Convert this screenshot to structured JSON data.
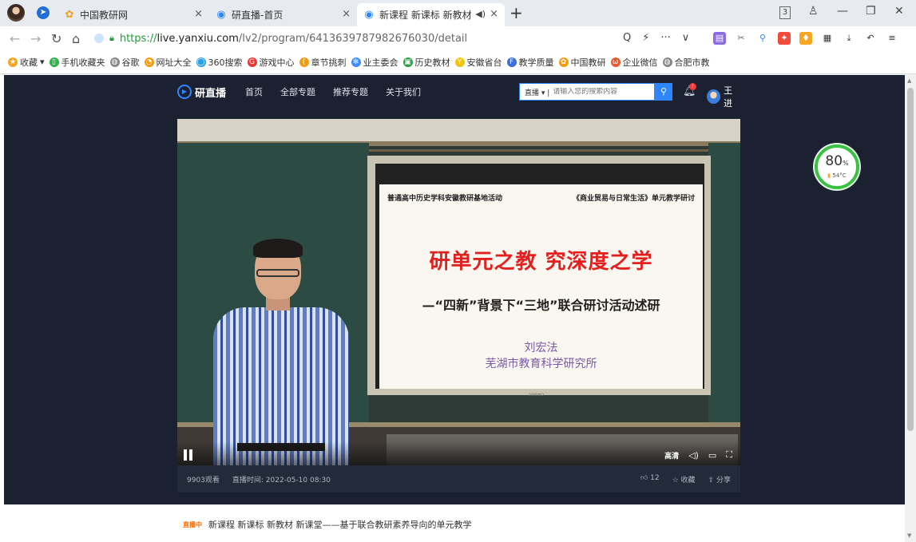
{
  "browser": {
    "tabs": [
      {
        "title": "中国教研网",
        "close": "×"
      },
      {
        "title": "研直播-首页",
        "close": "×"
      },
      {
        "title": "新课程  新课标  新教材",
        "close": "×",
        "sound": "◀)"
      }
    ],
    "new_tab": "+",
    "window_controls": {
      "sidebar_count": "3",
      "minimize": "—",
      "restore": "❐",
      "close": "✕"
    },
    "url": {
      "scheme": "https://",
      "host": "live.yanxiu.com",
      "path": "/lv2/program/6413639787982676030/detail"
    },
    "url_tools": [
      "Q",
      "⚡",
      "···",
      "∨"
    ],
    "bookmarks": [
      {
        "label": "收藏",
        "color": "#f5a623"
      },
      {
        "label": "手机收藏夹",
        "color": "#2fb24a"
      },
      {
        "label": "谷歌",
        "color": "#888888"
      },
      {
        "label": "网址大全",
        "color": "#f39c12"
      },
      {
        "label": "360搜索",
        "color": "#2aa1e6"
      },
      {
        "label": "游戏中心",
        "color": "#e53935"
      },
      {
        "label": "章节挑刺",
        "color": "#f39c12"
      },
      {
        "label": "业主委会",
        "color": "#3d8bfd"
      },
      {
        "label": "历史教材",
        "color": "#2e9d46"
      },
      {
        "label": "安徽省台",
        "color": "#f1c40f"
      },
      {
        "label": "教学质量",
        "color": "#3d6cd6"
      },
      {
        "label": "中国教研",
        "color": "#f39c12"
      },
      {
        "label": "企业微信",
        "color": "#e65b2f"
      },
      {
        "label": "合肥市教",
        "color": "#888888"
      }
    ]
  },
  "site": {
    "logo": "研直播",
    "nav": [
      "首页",
      "全部专题",
      "推荐专题",
      "关于我们"
    ],
    "search_scope": "直播 ▾ |",
    "search_placeholder": "请输入您的搜索内容",
    "notification_count": "!",
    "user_name": "王进"
  },
  "video": {
    "slide": {
      "header_left": "普通高中历史学科安徽教研基地活动",
      "header_right": "《商业贸易与日常生活》单元教学研讨",
      "title": "研单元之教  究深度之学",
      "subtitle": "—“四新”背景下“三地”联合研讨活动述研",
      "author": "刘宏法",
      "org": "芜湖市教育科学研究所",
      "brand": "seewo"
    },
    "controls": {
      "quality": "高清",
      "volume": "◁)",
      "pip": "▭",
      "fullscreen": "⛶"
    }
  },
  "info": {
    "views": "9903观看",
    "live_time": "直播时间: 2022-05-10 08:30",
    "likes": "12",
    "favorite": "收藏",
    "share": "分享"
  },
  "below": {
    "badge": "直播中",
    "title": "新课程  新课标  新教材  新课堂——基于联合教研素养导向的单元教学"
  },
  "perf_widget": {
    "percent": "80",
    "unit": "%",
    "temp": "54°C"
  }
}
